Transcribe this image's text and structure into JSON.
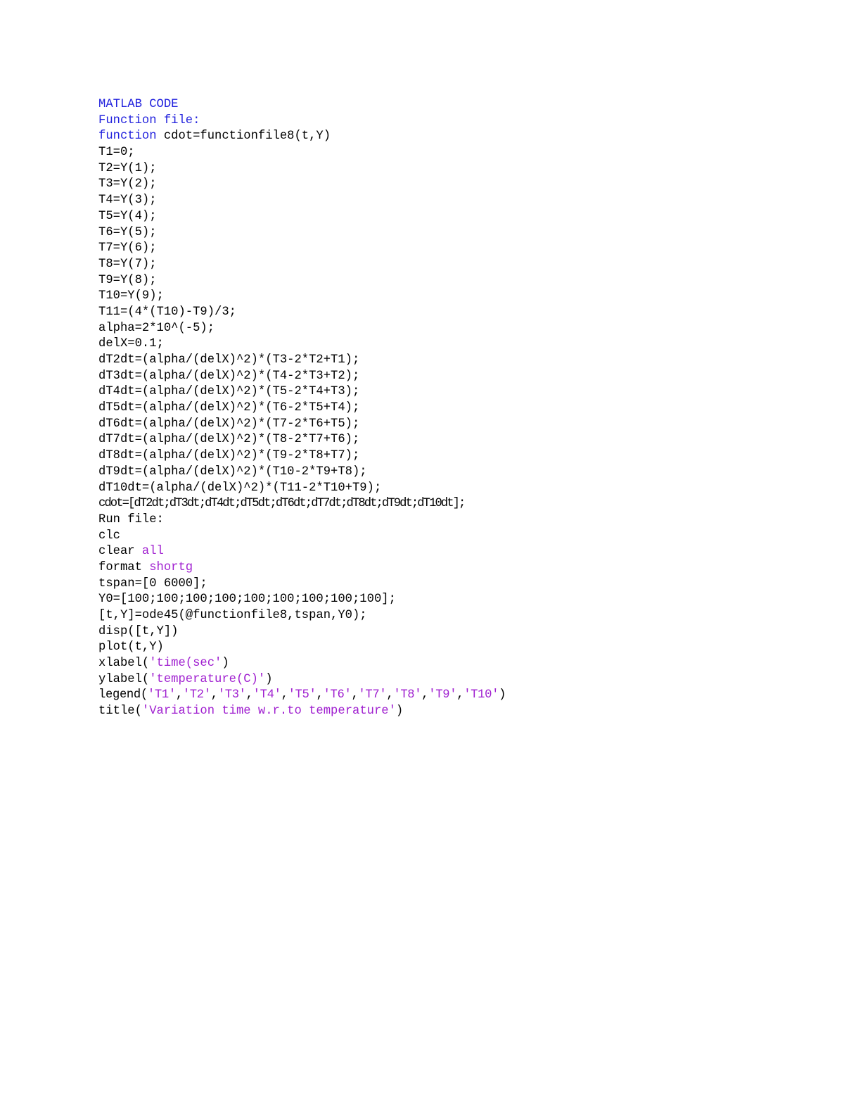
{
  "document": {
    "background_color": "#ffffff",
    "text_color": "#000000",
    "keyword_color": "#2222DD",
    "string_color": "#A020D0",
    "heading": "MATLAB CODE",
    "section_function_file": "Function file:",
    "section_run_file": "Run file:"
  },
  "code": {
    "lines": [
      {
        "id": "l01",
        "text": "MATLAB CODE",
        "segments": [
          {
            "t": "MATLAB CODE",
            "c": "head"
          }
        ]
      },
      {
        "id": "l02",
        "text": "Function file:",
        "segments": [
          {
            "t": "Function file:",
            "c": "head"
          }
        ]
      },
      {
        "id": "l03",
        "text": "function cdot=functionfile8(t,Y)",
        "segments": [
          {
            "t": "function",
            "c": "kw"
          },
          {
            "t": " cdot=functionfile8(t,Y)",
            "c": "plain"
          }
        ]
      },
      {
        "id": "l04",
        "text": "T1=0;",
        "segments": [
          {
            "t": "T1=0;",
            "c": "plain"
          }
        ]
      },
      {
        "id": "l05",
        "text": "T2=Y(1);",
        "segments": [
          {
            "t": "T2=Y(1);",
            "c": "plain"
          }
        ]
      },
      {
        "id": "l06",
        "text": "T3=Y(2);",
        "segments": [
          {
            "t": "T3=Y(2);",
            "c": "plain"
          }
        ]
      },
      {
        "id": "l07",
        "text": "T4=Y(3);",
        "segments": [
          {
            "t": "T4=Y(3);",
            "c": "plain"
          }
        ]
      },
      {
        "id": "l08",
        "text": "T5=Y(4);",
        "segments": [
          {
            "t": "T5=Y(4);",
            "c": "plain"
          }
        ]
      },
      {
        "id": "l09",
        "text": "T6=Y(5);",
        "segments": [
          {
            "t": "T6=Y(5);",
            "c": "plain"
          }
        ]
      },
      {
        "id": "l10",
        "text": "T7=Y(6);",
        "segments": [
          {
            "t": "T7=Y(6);",
            "c": "plain"
          }
        ]
      },
      {
        "id": "l11",
        "text": "T8=Y(7);",
        "segments": [
          {
            "t": "T8=Y(7);",
            "c": "plain"
          }
        ]
      },
      {
        "id": "l12",
        "text": "T9=Y(8);",
        "segments": [
          {
            "t": "T9=Y(8);",
            "c": "plain"
          }
        ]
      },
      {
        "id": "l13",
        "text": "T10=Y(9);",
        "segments": [
          {
            "t": "T10=Y(9);",
            "c": "plain"
          }
        ]
      },
      {
        "id": "l14",
        "text": "T11=(4*(T10)-T9)/3;",
        "segments": [
          {
            "t": "T11=(4*(T10)-T9)/3;",
            "c": "plain"
          }
        ]
      },
      {
        "id": "l15",
        "text": "alpha=2*10^(-5);",
        "segments": [
          {
            "t": "alpha=2*10^(-5);",
            "c": "plain"
          }
        ]
      },
      {
        "id": "l16",
        "text": "delX=0.1;",
        "segments": [
          {
            "t": "delX=0.1;",
            "c": "plain"
          }
        ]
      },
      {
        "id": "l17",
        "text": "dT2dt=(alpha/(delX)^2)*(T3-2*T2+T1);",
        "segments": [
          {
            "t": "dT2dt=(alpha/(delX)^2)*(T3-2*T2+T1);",
            "c": "plain"
          }
        ]
      },
      {
        "id": "l18",
        "text": "dT3dt=(alpha/(delX)^2)*(T4-2*T3+T2);",
        "segments": [
          {
            "t": "dT3dt=(alpha/(delX)^2)*(T4-2*T3+T2);",
            "c": "plain"
          }
        ]
      },
      {
        "id": "l19",
        "text": "dT4dt=(alpha/(delX)^2)*(T5-2*T4+T3);",
        "segments": [
          {
            "t": "dT4dt=(alpha/(delX)^2)*(T5-2*T4+T3);",
            "c": "plain"
          }
        ]
      },
      {
        "id": "l20",
        "text": "dT5dt=(alpha/(delX)^2)*(T6-2*T5+T4);",
        "segments": [
          {
            "t": "dT5dt=(alpha/(delX)^2)*(T6-2*T5+T4);",
            "c": "plain"
          }
        ]
      },
      {
        "id": "l21",
        "text": "dT6dt=(alpha/(delX)^2)*(T7-2*T6+T5);",
        "segments": [
          {
            "t": "dT6dt=(alpha/(delX)^2)*(T7-2*T6+T5);",
            "c": "plain"
          }
        ]
      },
      {
        "id": "l22",
        "text": "dT7dt=(alpha/(delX)^2)*(T8-2*T7+T6);",
        "segments": [
          {
            "t": "dT7dt=(alpha/(delX)^2)*(T8-2*T7+T6);",
            "c": "plain"
          }
        ]
      },
      {
        "id": "l23",
        "text": "dT8dt=(alpha/(delX)^2)*(T9-2*T8+T7);",
        "segments": [
          {
            "t": "dT8dt=(alpha/(delX)^2)*(T9-2*T8+T7);",
            "c": "plain"
          }
        ]
      },
      {
        "id": "l24",
        "text": "dT9dt=(alpha/(delX)^2)*(T10-2*T9+T8);",
        "segments": [
          {
            "t": "dT9dt=(alpha/(delX)^2)*(T10-2*T9+T8);",
            "c": "plain"
          }
        ]
      },
      {
        "id": "l25",
        "text": "dT10dt=(alpha/(delX)^2)*(T11-2*T10+T9);",
        "segments": [
          {
            "t": "dT10dt=(alpha/(delX)^2)*(T11-2*T10+T9);",
            "c": "plain"
          }
        ]
      },
      {
        "id": "l26",
        "text": "cdot=[dT2dt;dT3dt;dT4dt;dT5dt;dT6dt;dT7dt;dT8dt;dT9dt;dT10dt];",
        "segments": [
          {
            "t": "cdot=[dT2dt;dT3dt;dT4dt;dT5dt;dT6dt;dT7dt;dT8dt;dT9dt;dT10dt];",
            "c": "plain"
          }
        ],
        "squeeze": 1
      },
      {
        "id": "l27",
        "text": "Run file:",
        "segments": [
          {
            "t": "Run file:",
            "c": "plain"
          }
        ]
      },
      {
        "id": "l28",
        "text": "clc",
        "segments": [
          {
            "t": "clc",
            "c": "plain"
          }
        ]
      },
      {
        "id": "l29",
        "text": "clear all",
        "segments": [
          {
            "t": "clear ",
            "c": "plain"
          },
          {
            "t": "all",
            "c": "str"
          }
        ]
      },
      {
        "id": "l30",
        "text": "format shortg",
        "segments": [
          {
            "t": "format ",
            "c": "plain"
          },
          {
            "t": "shortg",
            "c": "str"
          }
        ]
      },
      {
        "id": "l31",
        "text": "tspan=[0 6000];",
        "segments": [
          {
            "t": "tspan=[0 6000];",
            "c": "plain"
          }
        ]
      },
      {
        "id": "l32",
        "text": "Y0=[100;100;100;100;100;100;100;100;100];",
        "segments": [
          {
            "t": "Y0=[100;100;100;100;100;100;100;100;100];",
            "c": "plain"
          }
        ]
      },
      {
        "id": "l33",
        "text": "[t,Y]=ode45(@functionfile8,tspan,Y0);",
        "segments": [
          {
            "t": "[t,Y]=ode45(@functionfile8,tspan,Y0);",
            "c": "plain"
          }
        ]
      },
      {
        "id": "l34",
        "text": "disp([t,Y])",
        "segments": [
          {
            "t": "disp([t,Y])",
            "c": "plain"
          }
        ]
      },
      {
        "id": "l35",
        "text": "plot(t,Y)",
        "segments": [
          {
            "t": "plot(t,Y)",
            "c": "plain"
          }
        ]
      },
      {
        "id": "l36",
        "text": "xlabel('time(sec')",
        "segments": [
          {
            "t": "xlabel(",
            "c": "plain"
          },
          {
            "t": "'time(sec'",
            "c": "str"
          },
          {
            "t": ")",
            "c": "plain"
          }
        ]
      },
      {
        "id": "l37",
        "text": "ylabel('temperature(C)')",
        "segments": [
          {
            "t": "ylabel(",
            "c": "plain"
          },
          {
            "t": "'temperature(C)'",
            "c": "str"
          },
          {
            "t": ")",
            "c": "plain"
          }
        ]
      },
      {
        "id": "l38",
        "text": "legend('T1','T2','T3','T4','T5','T6','T7','T8','T9','T10')",
        "segments": [
          {
            "t": "legend(",
            "c": "plain"
          },
          {
            "t": "'T1'",
            "c": "str"
          },
          {
            "t": ",",
            "c": "plain"
          },
          {
            "t": "'T2'",
            "c": "str"
          },
          {
            "t": ",",
            "c": "plain"
          },
          {
            "t": "'T3'",
            "c": "str"
          },
          {
            "t": ",",
            "c": "plain"
          },
          {
            "t": "'T4'",
            "c": "str"
          },
          {
            "t": ",",
            "c": "plain"
          },
          {
            "t": "'T5'",
            "c": "str"
          },
          {
            "t": ",",
            "c": "plain"
          },
          {
            "t": "'T6'",
            "c": "str"
          },
          {
            "t": ",",
            "c": "plain"
          },
          {
            "t": "'T7'",
            "c": "str"
          },
          {
            "t": ",",
            "c": "plain"
          },
          {
            "t": "'T8'",
            "c": "str"
          },
          {
            "t": ",",
            "c": "plain"
          },
          {
            "t": "'T9'",
            "c": "str"
          },
          {
            "t": ",",
            "c": "plain"
          },
          {
            "t": "'T10'",
            "c": "str"
          },
          {
            "t": ")",
            "c": "plain"
          }
        ],
        "squeeze": 2
      },
      {
        "id": "l39",
        "text": "title('Variation time w.r.to temperature')",
        "segments": [
          {
            "t": "title(",
            "c": "plain"
          },
          {
            "t": "'Variation time w.r.to temperature'",
            "c": "str"
          },
          {
            "t": ")",
            "c": "plain"
          }
        ]
      }
    ]
  }
}
